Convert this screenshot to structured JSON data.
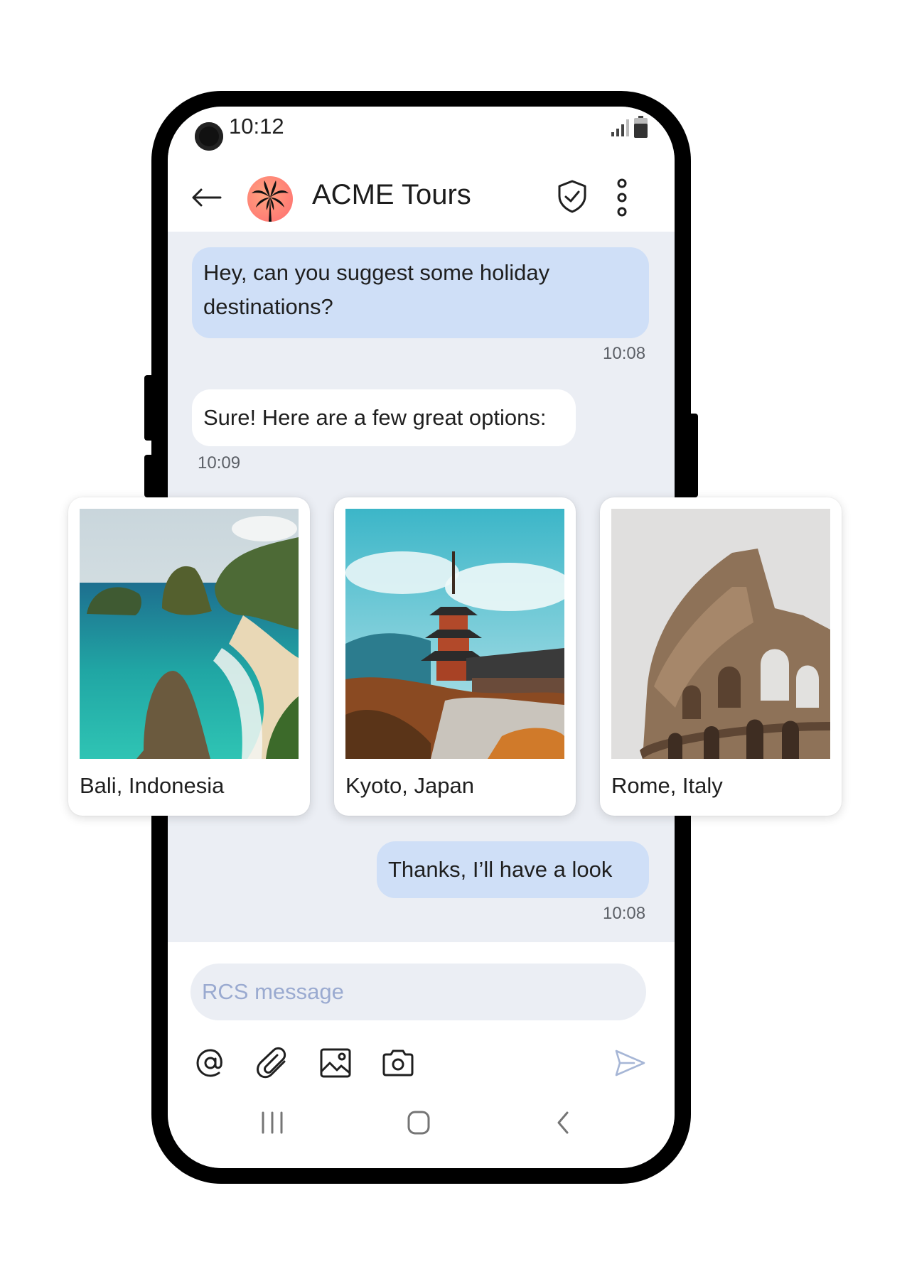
{
  "status_bar": {
    "time": "10:12"
  },
  "header": {
    "title": "ACME Tours"
  },
  "messages": [
    {
      "text": "Hey, can you suggest some holiday destinations?",
      "time": "10:08"
    },
    {
      "text": "Sure! Here are a few great options:",
      "time": "10:09"
    },
    {
      "text": "Thanks, I’ll have a look",
      "time": "10:08"
    }
  ],
  "cards": [
    {
      "label": "Bali, Indonesia"
    },
    {
      "label": "Kyoto, Japan"
    },
    {
      "label": "Rome, Italy"
    }
  ],
  "composer": {
    "placeholder": "RCS message"
  },
  "icons": {
    "status": [
      "camera-icon",
      "signal-icon",
      "battery-icon"
    ],
    "header": [
      "back-arrow-icon",
      "palm-tree-icon",
      "verified-shield-icon",
      "more-vertical-icon"
    ],
    "toolbar": [
      "at-sign-icon",
      "paperclip-icon",
      "image-icon",
      "camera-icon",
      "send-icon"
    ],
    "nav": [
      "recent-apps-icon",
      "home-icon",
      "back-icon"
    ]
  },
  "colors": {
    "outgoing_bubble": "#cfdff7",
    "incoming_bubble": "#ffffff",
    "chat_background": "#ebeef4",
    "avatar": "#ff7f6f",
    "placeholder": "#9aaad0"
  }
}
